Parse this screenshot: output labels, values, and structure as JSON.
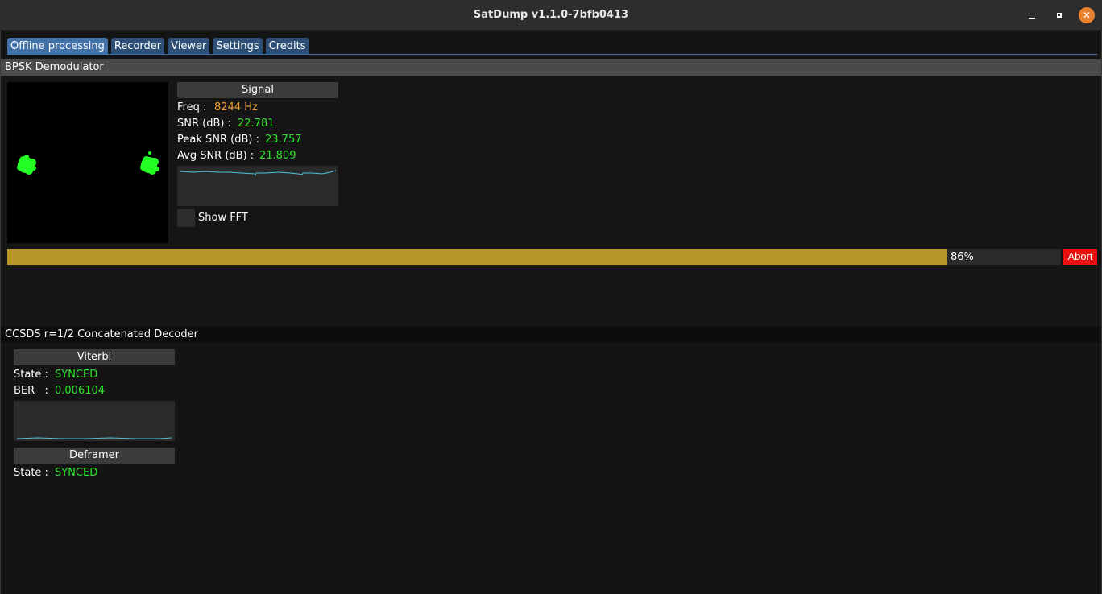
{
  "window": {
    "title": "SatDump v1.1.0-7bfb0413"
  },
  "tabs": [
    {
      "label": "Offline processing",
      "active": true
    },
    {
      "label": "Recorder"
    },
    {
      "label": "Viewer"
    },
    {
      "label": "Settings"
    },
    {
      "label": "Credits"
    }
  ],
  "demodulator": {
    "title": "BPSK Demodulator",
    "signal": {
      "header": "Signal",
      "freq_label": "Freq :",
      "freq_value": "8244 Hz",
      "snr_label": "SNR (dB) :",
      "snr_value": "22.781",
      "peak_label": "Peak SNR (dB) :",
      "peak_value": "23.757",
      "avg_label": "Avg SNR (dB) :",
      "avg_value": "21.809"
    },
    "show_fft_label": "Show FFT",
    "show_fft_checked": false,
    "progress": {
      "percent": 86,
      "label": "86%"
    },
    "abort_label": "Abort"
  },
  "decoder": {
    "title": "CCSDS r=1/2 Concatenated Decoder",
    "viterbi": {
      "header": "Viterbi",
      "state_label": "State :",
      "state_value": "SYNCED",
      "ber_label": "BER   :",
      "ber_value": "0.006104"
    },
    "deframer": {
      "header": "Deframer",
      "state_label": "State :",
      "state_value": "SYNCED"
    }
  },
  "colors": {
    "accent_tab": "#4271a8",
    "progress": "#b8962a",
    "abort": "#e81010",
    "synced": "#2ee62e",
    "freq": "#f0a030",
    "constellation_points": "#22ff22",
    "plot_line": "#4fc3d9"
  }
}
